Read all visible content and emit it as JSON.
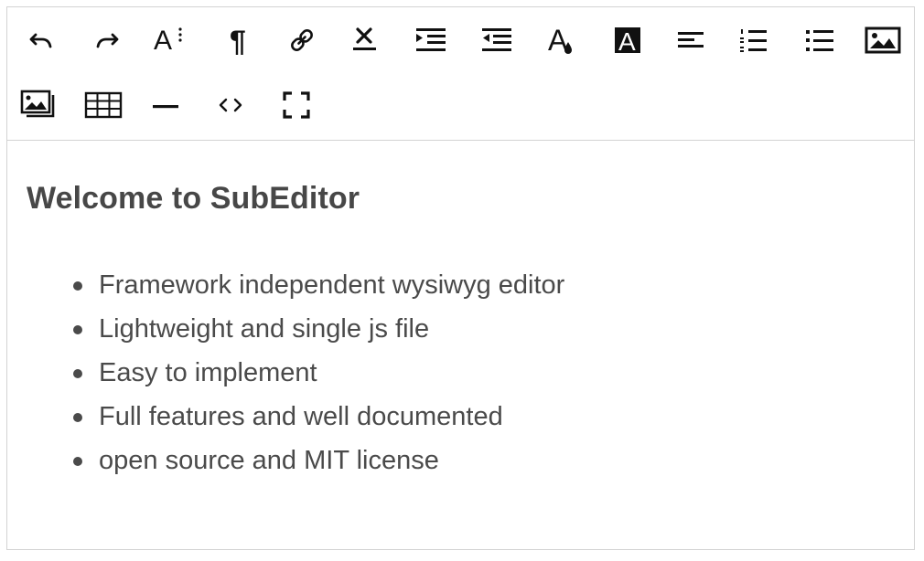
{
  "toolbar": {
    "buttons": [
      {
        "name": "undo-button",
        "icon": "undo-icon",
        "title": "Undo"
      },
      {
        "name": "redo-button",
        "icon": "redo-icon",
        "title": "Redo"
      },
      {
        "name": "font-size-button",
        "icon": "font-size-icon",
        "title": "Font size",
        "glyph": "A"
      },
      {
        "name": "paragraph-button",
        "icon": "pilcrow-icon",
        "title": "Paragraph",
        "glyph": "¶"
      },
      {
        "name": "link-button",
        "icon": "link-icon",
        "title": "Link"
      },
      {
        "name": "remove-format-button",
        "icon": "remove-format-icon",
        "title": "Remove format"
      },
      {
        "name": "indent-button",
        "icon": "indent-icon",
        "title": "Indent"
      },
      {
        "name": "outdent-button",
        "icon": "outdent-icon",
        "title": "Outdent"
      },
      {
        "name": "text-color-button",
        "icon": "text-color-icon",
        "title": "Text color",
        "glyph": "A"
      },
      {
        "name": "background-color-button",
        "icon": "background-color-icon",
        "title": "Background color",
        "glyph": "A"
      },
      {
        "name": "align-button",
        "icon": "align-left-icon",
        "title": "Align"
      },
      {
        "name": "ordered-list-button",
        "icon": "ordered-list-icon",
        "title": "Ordered list"
      },
      {
        "name": "unordered-list-button",
        "icon": "unordered-list-icon",
        "title": "Unordered list"
      },
      {
        "name": "insert-image-button",
        "icon": "image-icon",
        "title": "Insert image"
      },
      {
        "name": "gallery-button",
        "icon": "gallery-icon",
        "title": "Gallery"
      },
      {
        "name": "table-button",
        "icon": "table-icon",
        "title": "Table"
      },
      {
        "name": "horizontal-rule-button",
        "icon": "horizontal-rule-icon",
        "title": "Horizontal rule"
      },
      {
        "name": "source-code-button",
        "icon": "code-icon",
        "title": "Source code",
        "glyph": "<>"
      },
      {
        "name": "fullscreen-button",
        "icon": "fullscreen-icon",
        "title": "Fullscreen"
      }
    ]
  },
  "content": {
    "heading": "Welcome to SubEditor",
    "items": [
      "Framework independent wysiwyg editor",
      "Lightweight and single js file",
      "Easy to implement",
      "Full features and well documented",
      "open source and MIT license"
    ]
  },
  "colors": {
    "icon": "#111111",
    "text": "#4a4a4a",
    "border": "#d3d3d3"
  }
}
